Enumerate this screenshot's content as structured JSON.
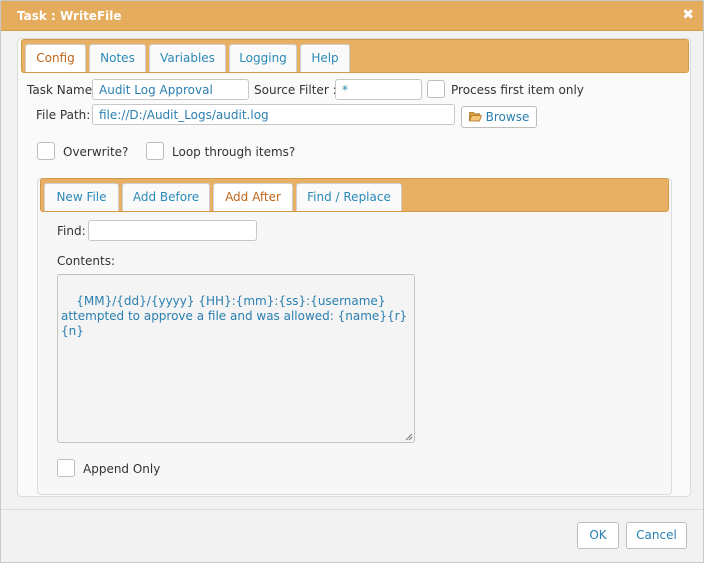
{
  "dialog": {
    "title": "Task : WriteFile",
    "close_label": "✖"
  },
  "main_tabs": [
    {
      "label": "Config",
      "active": true
    },
    {
      "label": "Notes",
      "active": false
    },
    {
      "label": "Variables",
      "active": false
    },
    {
      "label": "Logging",
      "active": false
    },
    {
      "label": "Help",
      "active": false
    }
  ],
  "config": {
    "task_name_label": "Task Name:",
    "task_name_value": "Audit Log Approval",
    "source_filter_label": "Source Filter :",
    "source_filter_value": "*",
    "process_first_label": "Process first item only",
    "process_first_checked": false,
    "file_path_label": "File Path:",
    "file_path_value": "file://D:/Audit_Logs/audit.log",
    "browse_label": "Browse",
    "overwrite_label": "Overwrite?",
    "overwrite_checked": false,
    "loop_label": "Loop through items?",
    "loop_checked": false
  },
  "sub_tabs": [
    {
      "label": "New File",
      "active": false
    },
    {
      "label": "Add Before",
      "active": false
    },
    {
      "label": "Add After",
      "active": true
    },
    {
      "label": "Find / Replace",
      "active": false
    }
  ],
  "add_after": {
    "find_label": "Find:",
    "find_value": "",
    "contents_label": "Contents:",
    "contents_value": "{MM}/{dd}/{yyyy} {HH}:{mm}:{ss}:{username} attempted to approve a file and was allowed: {name}{r}{n}",
    "append_only_label": "Append Only",
    "append_only_checked": false
  },
  "footer": {
    "ok_label": "OK",
    "cancel_label": "Cancel"
  },
  "colors": {
    "accent": "#e5ac5d",
    "link_text": "#2a7fb0",
    "active_tab_text": "#c0661a"
  },
  "icons": {
    "close": "close-icon",
    "browse": "folder-open-icon"
  }
}
